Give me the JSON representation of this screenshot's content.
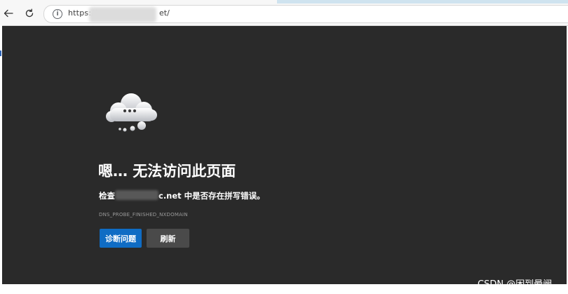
{
  "browser": {
    "url_prefix": "https://",
    "url_suffix": "et/",
    "back_icon": "back-arrow-icon",
    "reload_icon": "reload-icon",
    "info_icon": "info-icon"
  },
  "error_page": {
    "title": "嗯… 无法访问此页面",
    "check_prefix": "检查",
    "check_suffix": "c.net 中是否存在拼写错误。",
    "error_code": "DNS_PROBE_FINISHED_NXDOMAIN",
    "diagnose_label": "诊断问题",
    "refresh_label": "刷新",
    "illustration_icon": "cloud-ellipsis-icon"
  },
  "colors": {
    "page_background": "#2a2a2a",
    "primary_button": "#0f6cc4",
    "secondary_button": "#4a4a4a"
  },
  "watermark": {
    "text": "CSDN @困到晕阙"
  }
}
